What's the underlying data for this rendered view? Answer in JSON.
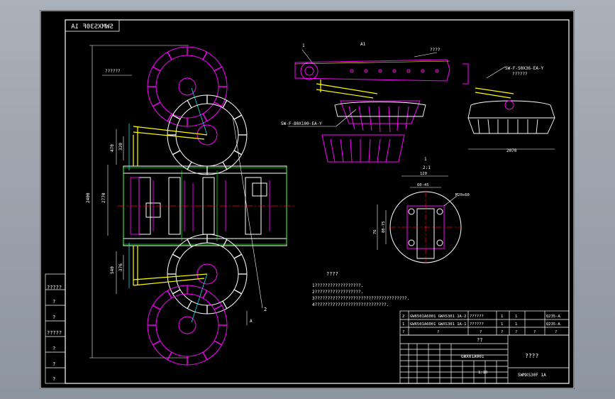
{
  "drawing": {
    "stamp_mirrored": "SWMXS30F 1A",
    "top_dimension": "??????",
    "top_view_label": "A1",
    "section_mark": "1",
    "dims_left": [
      "2400",
      "470",
      "320",
      "2770",
      "540",
      "376"
    ],
    "arm_callout_top": "????",
    "arm_label_a": "SW-F-S0X36-EA-Y",
    "arm_label_a_sub": "??????",
    "arm_label_b": "SW-F-80X100-EA-Y",
    "width_dim": "2070",
    "section_title": "1",
    "section_sub": "2:1",
    "bolt_dims": [
      "120",
      "60-45",
      "80-75",
      "76"
    ],
    "bolt_note": "M20x60",
    "pointer_2": "2",
    "arrow_label": "A",
    "notes_title": "????",
    "notes": [
      "1??????????????????.",
      "2??????????????????.",
      "3????????????????????????????????????.",
      "4????????????????????????????."
    ]
  },
  "bom": {
    "rows": [
      {
        "num": "2",
        "code": "GW6501A6001 GWXS301 1A-2",
        "name": "??????",
        "qty": "1",
        "unit": "1",
        "material": "Q235-A"
      },
      {
        "num": "1",
        "code": "GW6501A6001 GWXS301 1A-1",
        "name": "??????",
        "qty": "1",
        "unit": "1",
        "material": "Q235-A"
      }
    ],
    "header": [
      "?",
      "?",
      "?",
      "?",
      "?",
      "?",
      "?"
    ]
  },
  "titleblock": {
    "units": "??",
    "part_code": "GWX01A001",
    "title": "????",
    "scale": "1:10",
    "drawing_no": "SWMXS30F 1A",
    "left_block": [
      "?????",
      "?",
      "?",
      "?????",
      "?",
      "?",
      "?"
    ]
  },
  "colors": {
    "frame": "#ffffff",
    "magenta": "#ff00ff",
    "yellow": "#ffff00",
    "cyan": "#00ffff",
    "green": "#00ff00",
    "red": "#ff0000",
    "white": "#ffffff"
  }
}
